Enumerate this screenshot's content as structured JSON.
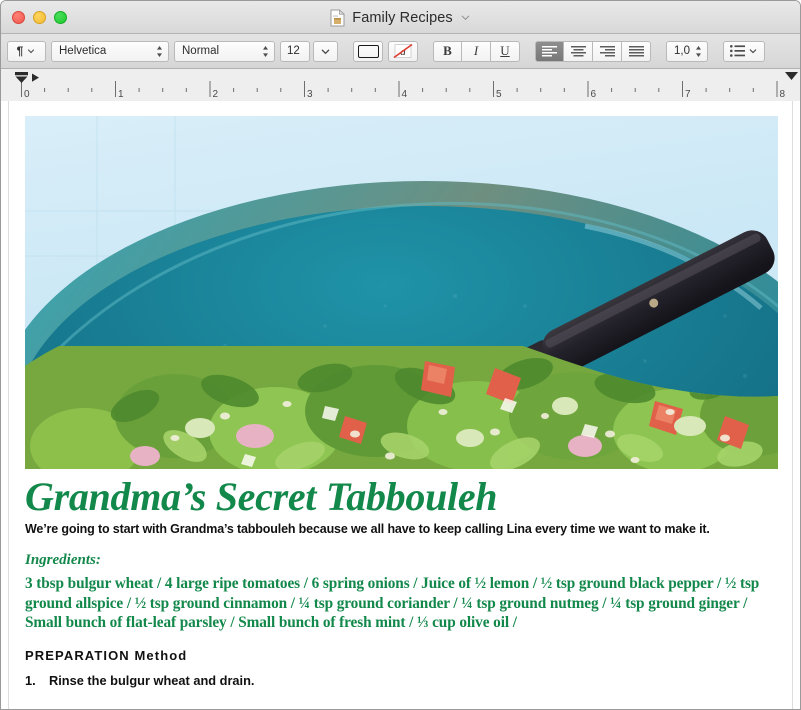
{
  "window": {
    "title": "Family Recipes",
    "title_chevron_icon": "chevron-down-icon",
    "doc_icon": "document-icon",
    "traffic_lights": [
      {
        "name": "close-button",
        "color": "#ef564c"
      },
      {
        "name": "minimize-button",
        "color": "#f2bb31"
      },
      {
        "name": "zoom-button",
        "color": "#1ec92f"
      }
    ]
  },
  "toolbar": {
    "paragraph_style_label": "¶",
    "font_family": "Helvetica",
    "text_style": "Normal",
    "font_size": "12",
    "text_color": "#000000",
    "no_color_label": "a",
    "bold_label": "B",
    "italic_label": "I",
    "underline_label": "U",
    "align_selected_index": 0,
    "line_spacing": "1,0",
    "list_icon": "bullet-list-icon",
    "chevron_icon": "chevron-down-icon",
    "stepper_icon": "stepper-up-down-icon"
  },
  "ruler": {
    "unit_labels": [
      "0",
      "1",
      "2",
      "3",
      "4",
      "5",
      "6",
      "7",
      "8"
    ],
    "left_indent_marker": "first-line-indent-marker",
    "left_margin_marker": "left-indent-marker",
    "right_margin_marker": "right-indent-marker"
  },
  "document": {
    "photo_alt": "tabbouleh-salad-in-teal-bowl-with-spoon",
    "title": "Grandma’s Secret Tabbouleh",
    "title_color": "#13884b",
    "intro": "We’re going to start with Grandma’s tabbouleh because we all have to keep calling Lina every time we want to make it.",
    "ingredients_heading": "Ingredients:",
    "ingredients_text": "3 tbsp bulgur wheat / 4 large ripe tomatoes / 6 spring onions / Juice of ½ lemon / ½ tsp ground black pepper / ½ tsp ground allspice /  ½ tsp ground cinnamon / ¼ tsp ground coriander / ¼ tsp ground nutmeg / ¼ tsp ground ginger / Small bunch of flat-leaf parsley / Small bunch of fresh mint / ⅓ cup olive oil /",
    "preparation_heading": "PREPARATION Method",
    "steps": [
      {
        "number": "1.",
        "text": "Rinse the bulgur wheat and drain."
      }
    ]
  }
}
